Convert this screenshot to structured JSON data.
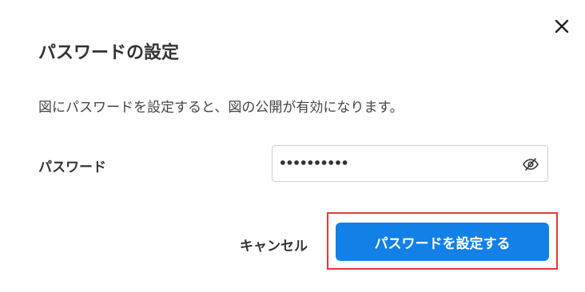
{
  "dialog": {
    "title": "パスワードの設定",
    "description": "図にパスワードを設定すると、図の公開が有効になります。",
    "close_icon": "close-icon",
    "password": {
      "label": "パスワード",
      "value": "••••••••••",
      "toggle_icon": "eye-slash-icon"
    },
    "cancel_label": "キャンセル",
    "submit_label": "パスワードを設定する",
    "highlight_color": "#e53935",
    "primary_color": "#1280e6"
  }
}
